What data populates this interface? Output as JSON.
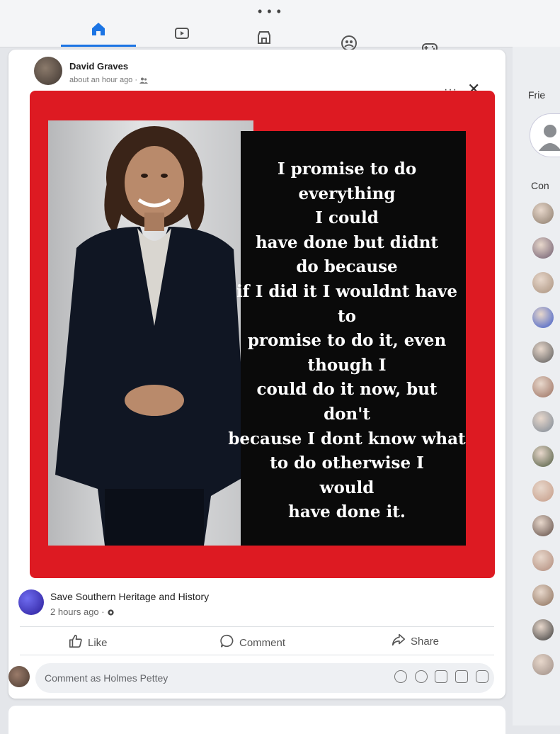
{
  "nav": {
    "more_label": "• • •",
    "icons": [
      "home-icon",
      "video-icon",
      "marketplace-icon",
      "groups-icon",
      "gaming-icon"
    ],
    "accent_color": "#1b74e4"
  },
  "post": {
    "author": "David Graves",
    "timestamp": "about an hour ago ·",
    "privacy_icon": "friends-icon",
    "more_label": "···",
    "close_label": "✕"
  },
  "shared_image": {
    "frame_color": "#dd1a22",
    "quote": "I promise to do\neverything\nI could\nhave done but didnt\ndo because\nif I did it I wouldnt have\nto\npromise to do it, even\nthough I\ncould do it now, but\ndon't\nbecause I dont know what\nto do otherwise I\nwould\nhave done it."
  },
  "source": {
    "name": "Save Southern Heritage and History",
    "timestamp": "2 hours ago ·"
  },
  "actions": {
    "like": "Like",
    "comment": "Comment",
    "share": "Share"
  },
  "composer": {
    "placeholder": "Comment as Holmes Pettey",
    "icons": [
      "avatar-sticker-icon",
      "emoji-icon",
      "camera-icon",
      "gif-icon",
      "sticker-icon"
    ]
  },
  "sidebar": {
    "friends_label": "Frie",
    "contacts_label": "Con",
    "contact_colors": [
      "#8a7a6a",
      "#6d5a6e",
      "#a8907c",
      "#3b59c8",
      "#5a5a5a",
      "#9a6f5f",
      "#7b8794",
      "#4e5a3f",
      "#c49a86",
      "#5e4b44",
      "#b08a7a",
      "#8b6f5a",
      "#3a3a3a",
      "#9c8c84"
    ]
  }
}
